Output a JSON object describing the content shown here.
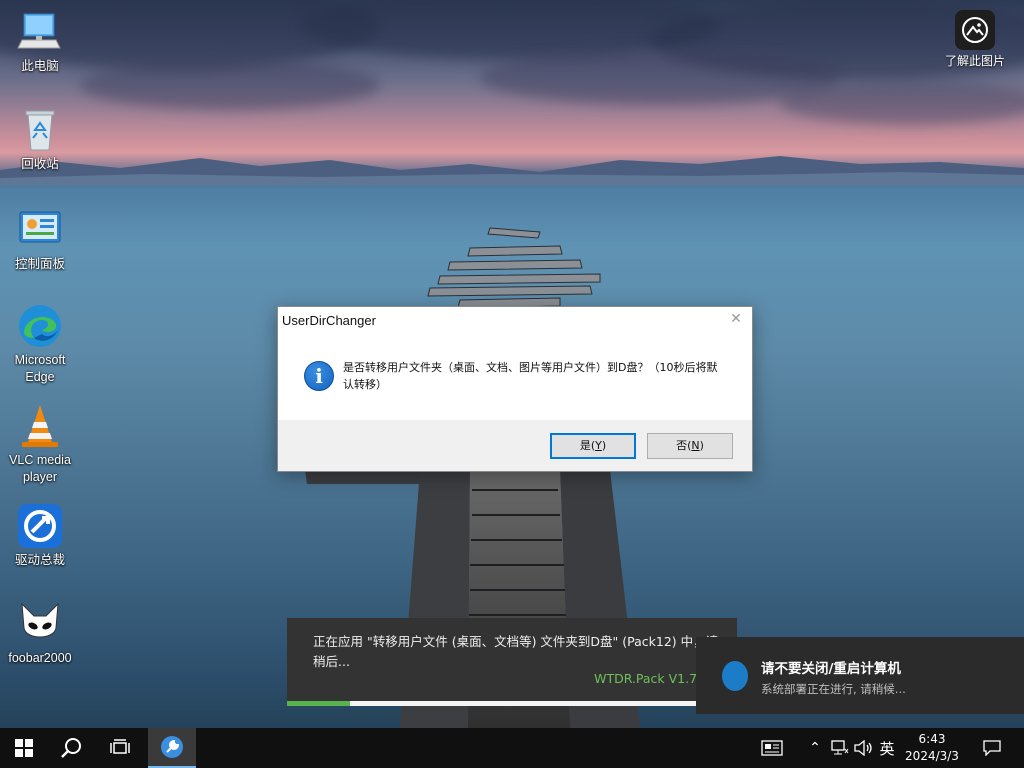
{
  "desktop": {
    "icons": [
      {
        "label": "此电脑"
      },
      {
        "label": "回收站"
      },
      {
        "label": "控制面板"
      },
      {
        "label": "Microsoft Edge"
      },
      {
        "label": "VLC media player"
      },
      {
        "label": "驱动总裁"
      },
      {
        "label": "foobar2000"
      }
    ],
    "learn_label": "了解此图片"
  },
  "dialog": {
    "title": "UserDirChanger",
    "message": "是否转移用户文件夹（桌面、文档、图片等用户文件）到D盘？（10秒后将默认转移）",
    "yes_label": "是",
    "yes_key": "Y",
    "no_label": "否",
    "no_key": "N"
  },
  "progress": {
    "text": "正在应用 \"转移用户文件 (桌面、文档等) 文件夹到D盘\" (Pack12) 中，请稍后...",
    "version": "WTDR.Pack V1.7.1",
    "fraction": 0.14
  },
  "toast": {
    "title": "请不要关闭/重启计算机",
    "subtitle": "系统部署正在进行, 请稍候..."
  },
  "taskbar": {
    "ime": "英",
    "time": "6:43",
    "date": "2024/3/3"
  },
  "colors": {
    "accent": "#0078d7",
    "progress": "#58b24e",
    "version_text": "#6fbf5a"
  }
}
